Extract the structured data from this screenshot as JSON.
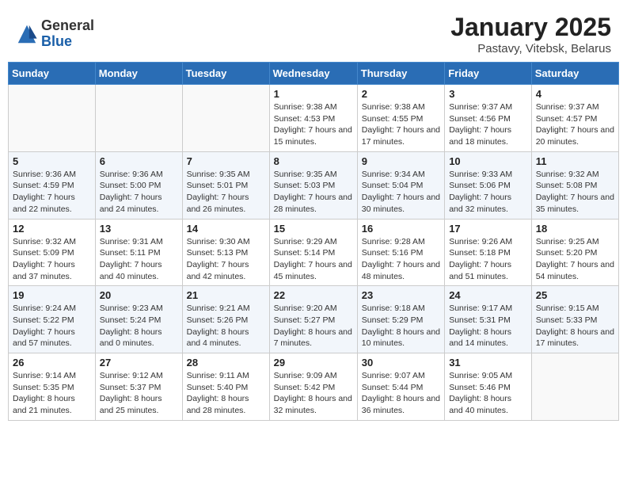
{
  "header": {
    "logo_general": "General",
    "logo_blue": "Blue",
    "month_title": "January 2025",
    "location": "Pastavy, Vitebsk, Belarus"
  },
  "weekdays": [
    "Sunday",
    "Monday",
    "Tuesday",
    "Wednesday",
    "Thursday",
    "Friday",
    "Saturday"
  ],
  "weeks": [
    [
      {
        "num": "",
        "info": ""
      },
      {
        "num": "",
        "info": ""
      },
      {
        "num": "",
        "info": ""
      },
      {
        "num": "1",
        "info": "Sunrise: 9:38 AM\nSunset: 4:53 PM\nDaylight: 7 hours and 15 minutes."
      },
      {
        "num": "2",
        "info": "Sunrise: 9:38 AM\nSunset: 4:55 PM\nDaylight: 7 hours and 17 minutes."
      },
      {
        "num": "3",
        "info": "Sunrise: 9:37 AM\nSunset: 4:56 PM\nDaylight: 7 hours and 18 minutes."
      },
      {
        "num": "4",
        "info": "Sunrise: 9:37 AM\nSunset: 4:57 PM\nDaylight: 7 hours and 20 minutes."
      }
    ],
    [
      {
        "num": "5",
        "info": "Sunrise: 9:36 AM\nSunset: 4:59 PM\nDaylight: 7 hours and 22 minutes."
      },
      {
        "num": "6",
        "info": "Sunrise: 9:36 AM\nSunset: 5:00 PM\nDaylight: 7 hours and 24 minutes."
      },
      {
        "num": "7",
        "info": "Sunrise: 9:35 AM\nSunset: 5:01 PM\nDaylight: 7 hours and 26 minutes."
      },
      {
        "num": "8",
        "info": "Sunrise: 9:35 AM\nSunset: 5:03 PM\nDaylight: 7 hours and 28 minutes."
      },
      {
        "num": "9",
        "info": "Sunrise: 9:34 AM\nSunset: 5:04 PM\nDaylight: 7 hours and 30 minutes."
      },
      {
        "num": "10",
        "info": "Sunrise: 9:33 AM\nSunset: 5:06 PM\nDaylight: 7 hours and 32 minutes."
      },
      {
        "num": "11",
        "info": "Sunrise: 9:32 AM\nSunset: 5:08 PM\nDaylight: 7 hours and 35 minutes."
      }
    ],
    [
      {
        "num": "12",
        "info": "Sunrise: 9:32 AM\nSunset: 5:09 PM\nDaylight: 7 hours and 37 minutes."
      },
      {
        "num": "13",
        "info": "Sunrise: 9:31 AM\nSunset: 5:11 PM\nDaylight: 7 hours and 40 minutes."
      },
      {
        "num": "14",
        "info": "Sunrise: 9:30 AM\nSunset: 5:13 PM\nDaylight: 7 hours and 42 minutes."
      },
      {
        "num": "15",
        "info": "Sunrise: 9:29 AM\nSunset: 5:14 PM\nDaylight: 7 hours and 45 minutes."
      },
      {
        "num": "16",
        "info": "Sunrise: 9:28 AM\nSunset: 5:16 PM\nDaylight: 7 hours and 48 minutes."
      },
      {
        "num": "17",
        "info": "Sunrise: 9:26 AM\nSunset: 5:18 PM\nDaylight: 7 hours and 51 minutes."
      },
      {
        "num": "18",
        "info": "Sunrise: 9:25 AM\nSunset: 5:20 PM\nDaylight: 7 hours and 54 minutes."
      }
    ],
    [
      {
        "num": "19",
        "info": "Sunrise: 9:24 AM\nSunset: 5:22 PM\nDaylight: 7 hours and 57 minutes."
      },
      {
        "num": "20",
        "info": "Sunrise: 9:23 AM\nSunset: 5:24 PM\nDaylight: 8 hours and 0 minutes."
      },
      {
        "num": "21",
        "info": "Sunrise: 9:21 AM\nSunset: 5:26 PM\nDaylight: 8 hours and 4 minutes."
      },
      {
        "num": "22",
        "info": "Sunrise: 9:20 AM\nSunset: 5:27 PM\nDaylight: 8 hours and 7 minutes."
      },
      {
        "num": "23",
        "info": "Sunrise: 9:18 AM\nSunset: 5:29 PM\nDaylight: 8 hours and 10 minutes."
      },
      {
        "num": "24",
        "info": "Sunrise: 9:17 AM\nSunset: 5:31 PM\nDaylight: 8 hours and 14 minutes."
      },
      {
        "num": "25",
        "info": "Sunrise: 9:15 AM\nSunset: 5:33 PM\nDaylight: 8 hours and 17 minutes."
      }
    ],
    [
      {
        "num": "26",
        "info": "Sunrise: 9:14 AM\nSunset: 5:35 PM\nDaylight: 8 hours and 21 minutes."
      },
      {
        "num": "27",
        "info": "Sunrise: 9:12 AM\nSunset: 5:37 PM\nDaylight: 8 hours and 25 minutes."
      },
      {
        "num": "28",
        "info": "Sunrise: 9:11 AM\nSunset: 5:40 PM\nDaylight: 8 hours and 28 minutes."
      },
      {
        "num": "29",
        "info": "Sunrise: 9:09 AM\nSunset: 5:42 PM\nDaylight: 8 hours and 32 minutes."
      },
      {
        "num": "30",
        "info": "Sunrise: 9:07 AM\nSunset: 5:44 PM\nDaylight: 8 hours and 36 minutes."
      },
      {
        "num": "31",
        "info": "Sunrise: 9:05 AM\nSunset: 5:46 PM\nDaylight: 8 hours and 40 minutes."
      },
      {
        "num": "",
        "info": ""
      }
    ]
  ]
}
